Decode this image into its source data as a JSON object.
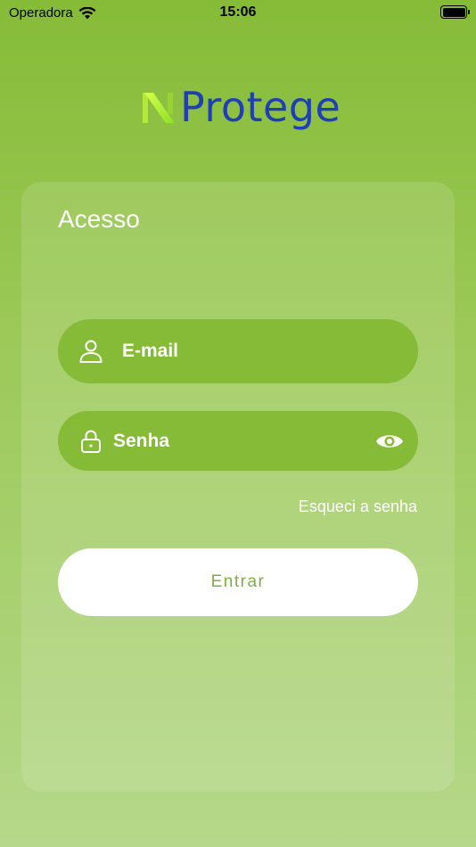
{
  "status_bar": {
    "carrier": "Operadora",
    "time": "15:06"
  },
  "logo": {
    "text": "Protege",
    "icon": "n-logo-icon"
  },
  "login": {
    "title": "Acesso",
    "email_placeholder": "E-mail",
    "password_placeholder": "Senha",
    "forgot_label": "Esqueci a senha",
    "submit_label": "Entrar"
  },
  "colors": {
    "primary_green": "#86bb37",
    "logo_blue": "#1f3fb8",
    "button_text": "#7fae41"
  }
}
